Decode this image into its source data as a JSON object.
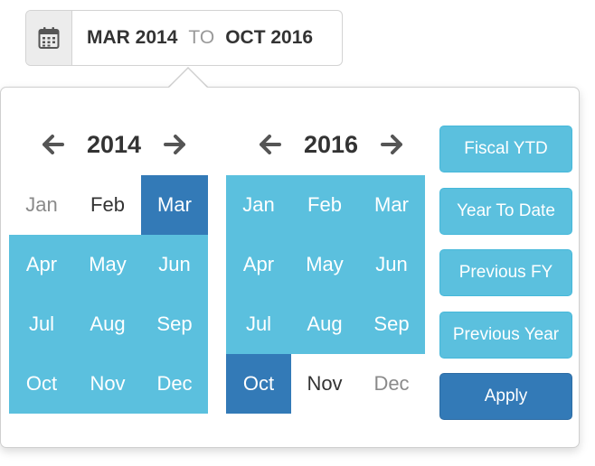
{
  "trigger": {
    "start": "MAR 2014",
    "separator": "TO",
    "end": "OCT 2016"
  },
  "left_calendar": {
    "year": "2014",
    "months": [
      {
        "label": "Jan",
        "state": "muted"
      },
      {
        "label": "Feb",
        "state": "edge"
      },
      {
        "label": "Mar",
        "state": "selected"
      },
      {
        "label": "Apr",
        "state": "in-range"
      },
      {
        "label": "May",
        "state": "in-range"
      },
      {
        "label": "Jun",
        "state": "in-range"
      },
      {
        "label": "Jul",
        "state": "in-range"
      },
      {
        "label": "Aug",
        "state": "in-range"
      },
      {
        "label": "Sep",
        "state": "in-range"
      },
      {
        "label": "Oct",
        "state": "in-range"
      },
      {
        "label": "Nov",
        "state": "in-range"
      },
      {
        "label": "Dec",
        "state": "in-range"
      }
    ]
  },
  "right_calendar": {
    "year": "2016",
    "months": [
      {
        "label": "Jan",
        "state": "in-range"
      },
      {
        "label": "Feb",
        "state": "in-range"
      },
      {
        "label": "Mar",
        "state": "in-range"
      },
      {
        "label": "Apr",
        "state": "in-range"
      },
      {
        "label": "May",
        "state": "in-range"
      },
      {
        "label": "Jun",
        "state": "in-range"
      },
      {
        "label": "Jul",
        "state": "in-range"
      },
      {
        "label": "Aug",
        "state": "in-range"
      },
      {
        "label": "Sep",
        "state": "in-range"
      },
      {
        "label": "Oct",
        "state": "selected"
      },
      {
        "label": "Nov",
        "state": "edge"
      },
      {
        "label": "Dec",
        "state": "muted"
      }
    ]
  },
  "presets": {
    "fiscal_ytd": "Fiscal YTD",
    "year_to_date": "Year To Date",
    "previous_fy": "Previous FY",
    "previous_year": "Previous Year",
    "apply": "Apply"
  },
  "icons": {
    "calendar": "calendar-icon",
    "prev": "arrow-left-icon",
    "next": "arrow-right-icon"
  },
  "colors": {
    "range": "#5bc0de",
    "selected": "#337ab7"
  }
}
